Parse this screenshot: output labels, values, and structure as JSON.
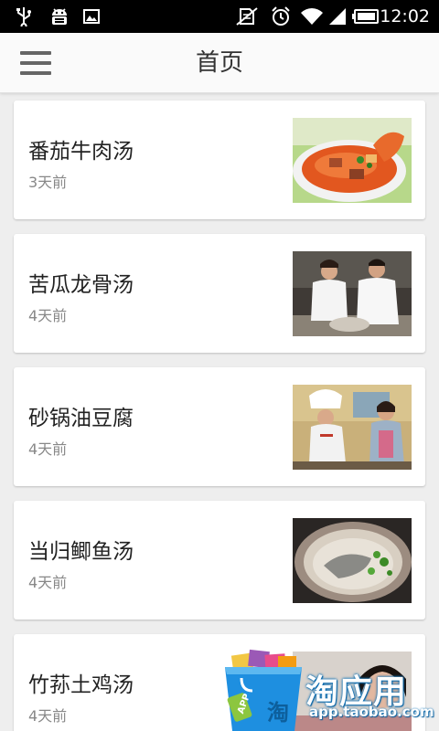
{
  "status_bar": {
    "time": "12:02",
    "icons": [
      "usb-icon",
      "android-debug-icon",
      "gallery-icon",
      "no-sim-icon",
      "alarm-icon",
      "wifi-icon",
      "signal-icon",
      "battery-icon"
    ]
  },
  "header": {
    "title": "首页",
    "menu_icon": "hamburger-menu-icon"
  },
  "recipes": [
    {
      "title": "番茄牛肉汤",
      "time": "3天前"
    },
    {
      "title": "苦瓜龙骨汤",
      "time": "4天前"
    },
    {
      "title": "砂锅油豆腐",
      "time": "4天前"
    },
    {
      "title": "当归鲫鱼汤",
      "time": "4天前"
    },
    {
      "title": "竹荪土鸡汤",
      "time": "4天前"
    }
  ],
  "promo": {
    "brand": "淘应用",
    "url": "app.taobao.com",
    "bag_text": "淘",
    "tag_text": "APP"
  },
  "colors": {
    "background": "#eeeeee",
    "card": "#ffffff",
    "title_text": "#222222",
    "meta_text": "#888888",
    "promo_blue": "#1e8fe0"
  }
}
